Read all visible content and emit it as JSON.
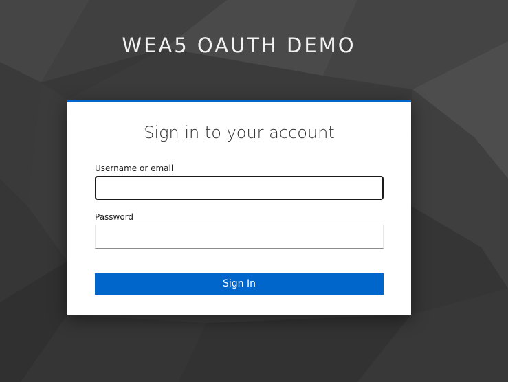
{
  "colors": {
    "background": "#3d3d3d",
    "accent": "#0066cc",
    "card": "#ffffff"
  },
  "realm": {
    "title": "WEA5 OAUTH DEMO"
  },
  "login": {
    "title": "Sign in to your account",
    "username": {
      "label": "Username or email",
      "value": "",
      "placeholder": ""
    },
    "password": {
      "label": "Password",
      "value": "",
      "placeholder": ""
    },
    "submit_label": "Sign In"
  }
}
